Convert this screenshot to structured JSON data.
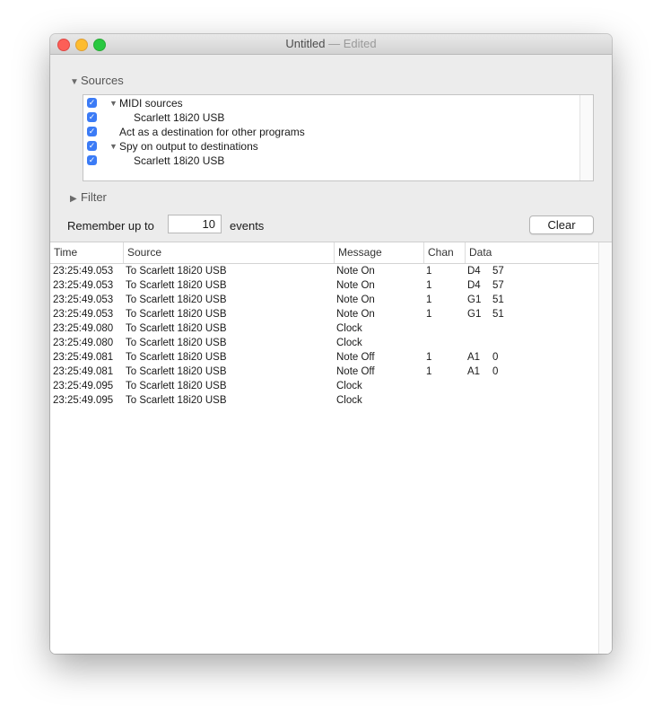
{
  "window": {
    "title": "Untitled",
    "edited": "— Edited"
  },
  "sources": {
    "label": "Sources",
    "rows": [
      {
        "label": "MIDI sources",
        "checked": true,
        "indent": 0,
        "disclosure": true
      },
      {
        "label": "Scarlett 18i20 USB",
        "checked": true,
        "indent": 1,
        "disclosure": false
      },
      {
        "label": "Act as a destination for other programs",
        "checked": true,
        "indent": 0,
        "disclosure": false
      },
      {
        "label": "Spy on output to destinations",
        "checked": true,
        "indent": 0,
        "disclosure": true
      },
      {
        "label": "Scarlett 18i20 USB",
        "checked": true,
        "indent": 1,
        "disclosure": false
      }
    ]
  },
  "filter": {
    "label": "Filter"
  },
  "remember": {
    "prefix": "Remember up to",
    "value": "10",
    "suffix": "events"
  },
  "clear_label": "Clear",
  "table": {
    "columns": [
      "Time",
      "Source",
      "Message",
      "Chan",
      "Data"
    ],
    "rows": [
      [
        "23:25:49.053",
        "To Scarlett 18i20 USB",
        "Note On",
        "1",
        "D4",
        "57"
      ],
      [
        "23:25:49.053",
        "To Scarlett 18i20 USB",
        "Note On",
        "1",
        "D4",
        "57"
      ],
      [
        "23:25:49.053",
        "To Scarlett 18i20 USB",
        "Note On",
        "1",
        "G1",
        "51"
      ],
      [
        "23:25:49.053",
        "To Scarlett 18i20 USB",
        "Note On",
        "1",
        "G1",
        "51"
      ],
      [
        "23:25:49.080",
        "To Scarlett 18i20 USB",
        "Clock",
        "",
        "",
        ""
      ],
      [
        "23:25:49.080",
        "To Scarlett 18i20 USB",
        "Clock",
        "",
        "",
        ""
      ],
      [
        "23:25:49.081",
        "To Scarlett 18i20 USB",
        "Note Off",
        "1",
        "A1",
        "0"
      ],
      [
        "23:25:49.081",
        "To Scarlett 18i20 USB",
        "Note Off",
        "1",
        "A1",
        "0"
      ],
      [
        "23:25:49.095",
        "To Scarlett 18i20 USB",
        "Clock",
        "",
        "",
        ""
      ],
      [
        "23:25:49.095",
        "To Scarlett 18i20 USB",
        "Clock",
        "",
        "",
        ""
      ]
    ]
  }
}
